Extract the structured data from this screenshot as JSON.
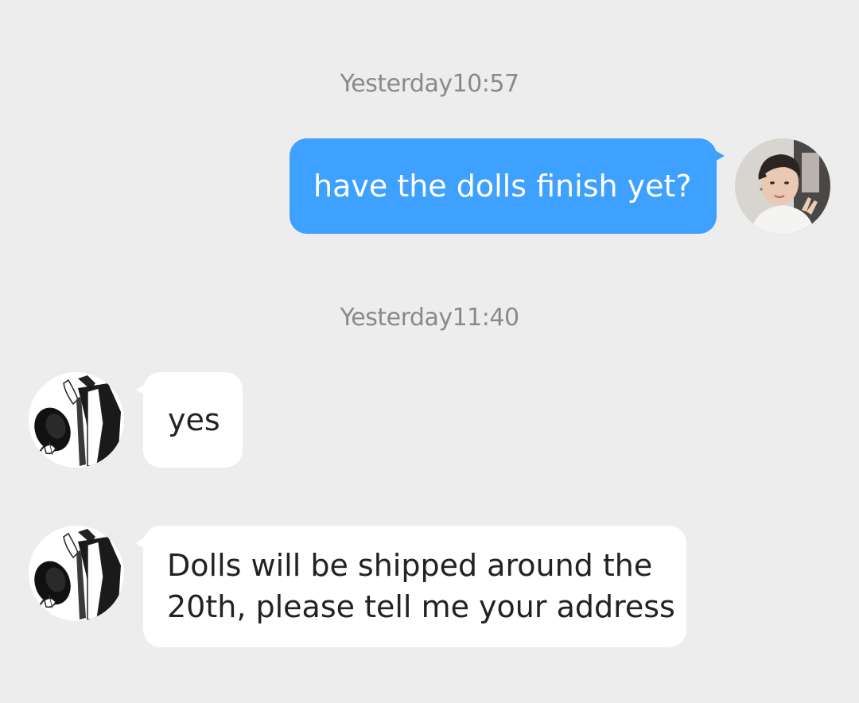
{
  "conversation": {
    "messages": [
      {
        "timestamp": "Yesterday10:57",
        "sender": "me",
        "text": "have the dolls finish yet?"
      },
      {
        "timestamp": "Yesterday11:40",
        "sender": "seller",
        "text": "yes"
      },
      {
        "sender": "seller",
        "text": "Dolls will be shipped around the\n20th, please tell me your address"
      }
    ]
  },
  "colors": {
    "background": "#ededed",
    "outgoing_bubble": "#3ea0ff",
    "incoming_bubble": "#ffffff",
    "timestamp_text": "#8a8a8a"
  },
  "icons": {
    "my_avatar": "profile-photo-avatar",
    "seller_avatar": "illustrated-figure-avatar"
  }
}
